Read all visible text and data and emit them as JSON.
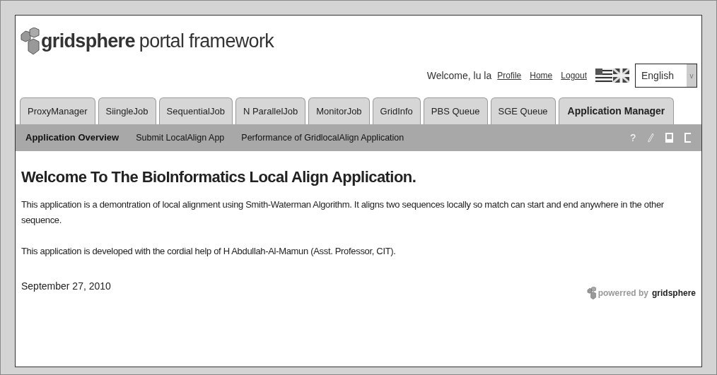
{
  "header": {
    "brand": "gridsphere",
    "tagline": "portal framework",
    "welcome": "Welcome, lu la",
    "links": [
      "Profile",
      "Home",
      "Logout"
    ],
    "language": "English",
    "dropdown_arrow": "v"
  },
  "tabs": [
    {
      "label": "ProxyManager",
      "selected": false
    },
    {
      "label": "SiingleJob",
      "selected": false
    },
    {
      "label": "SequentialJob",
      "selected": false
    },
    {
      "label": "N ParallelJob",
      "selected": false
    },
    {
      "label": "MonitorJob",
      "selected": false
    },
    {
      "label": "GridInfo",
      "selected": false
    },
    {
      "label": "PBS Queue",
      "selected": false
    },
    {
      "label": "SGE Queue",
      "selected": false
    },
    {
      "label": "Application Manager",
      "selected": true
    }
  ],
  "subtabs": [
    {
      "label": "Application Overview",
      "selected": true
    },
    {
      "label": "Submit LocalAlign App",
      "selected": false
    },
    {
      "label": "Performance of GridlocalAlign Application",
      "selected": false
    }
  ],
  "help": "?",
  "content": {
    "heading": "Welcome To The BioInformatics Local Align Application.",
    "paragraphs": [
      "This application is a demontration of local alignment using Smith-Waterman Algorithm. It aligns two sequences locally so match can start and end anywhere in the other sequence.",
      "This application is developed with the cordial help of H Abdullah-Al-Mamun (Asst. Professor, CIT)."
    ]
  },
  "footer": {
    "date": "September 27, 2010",
    "powered": "powerred by",
    "brand": "gridsphere"
  }
}
